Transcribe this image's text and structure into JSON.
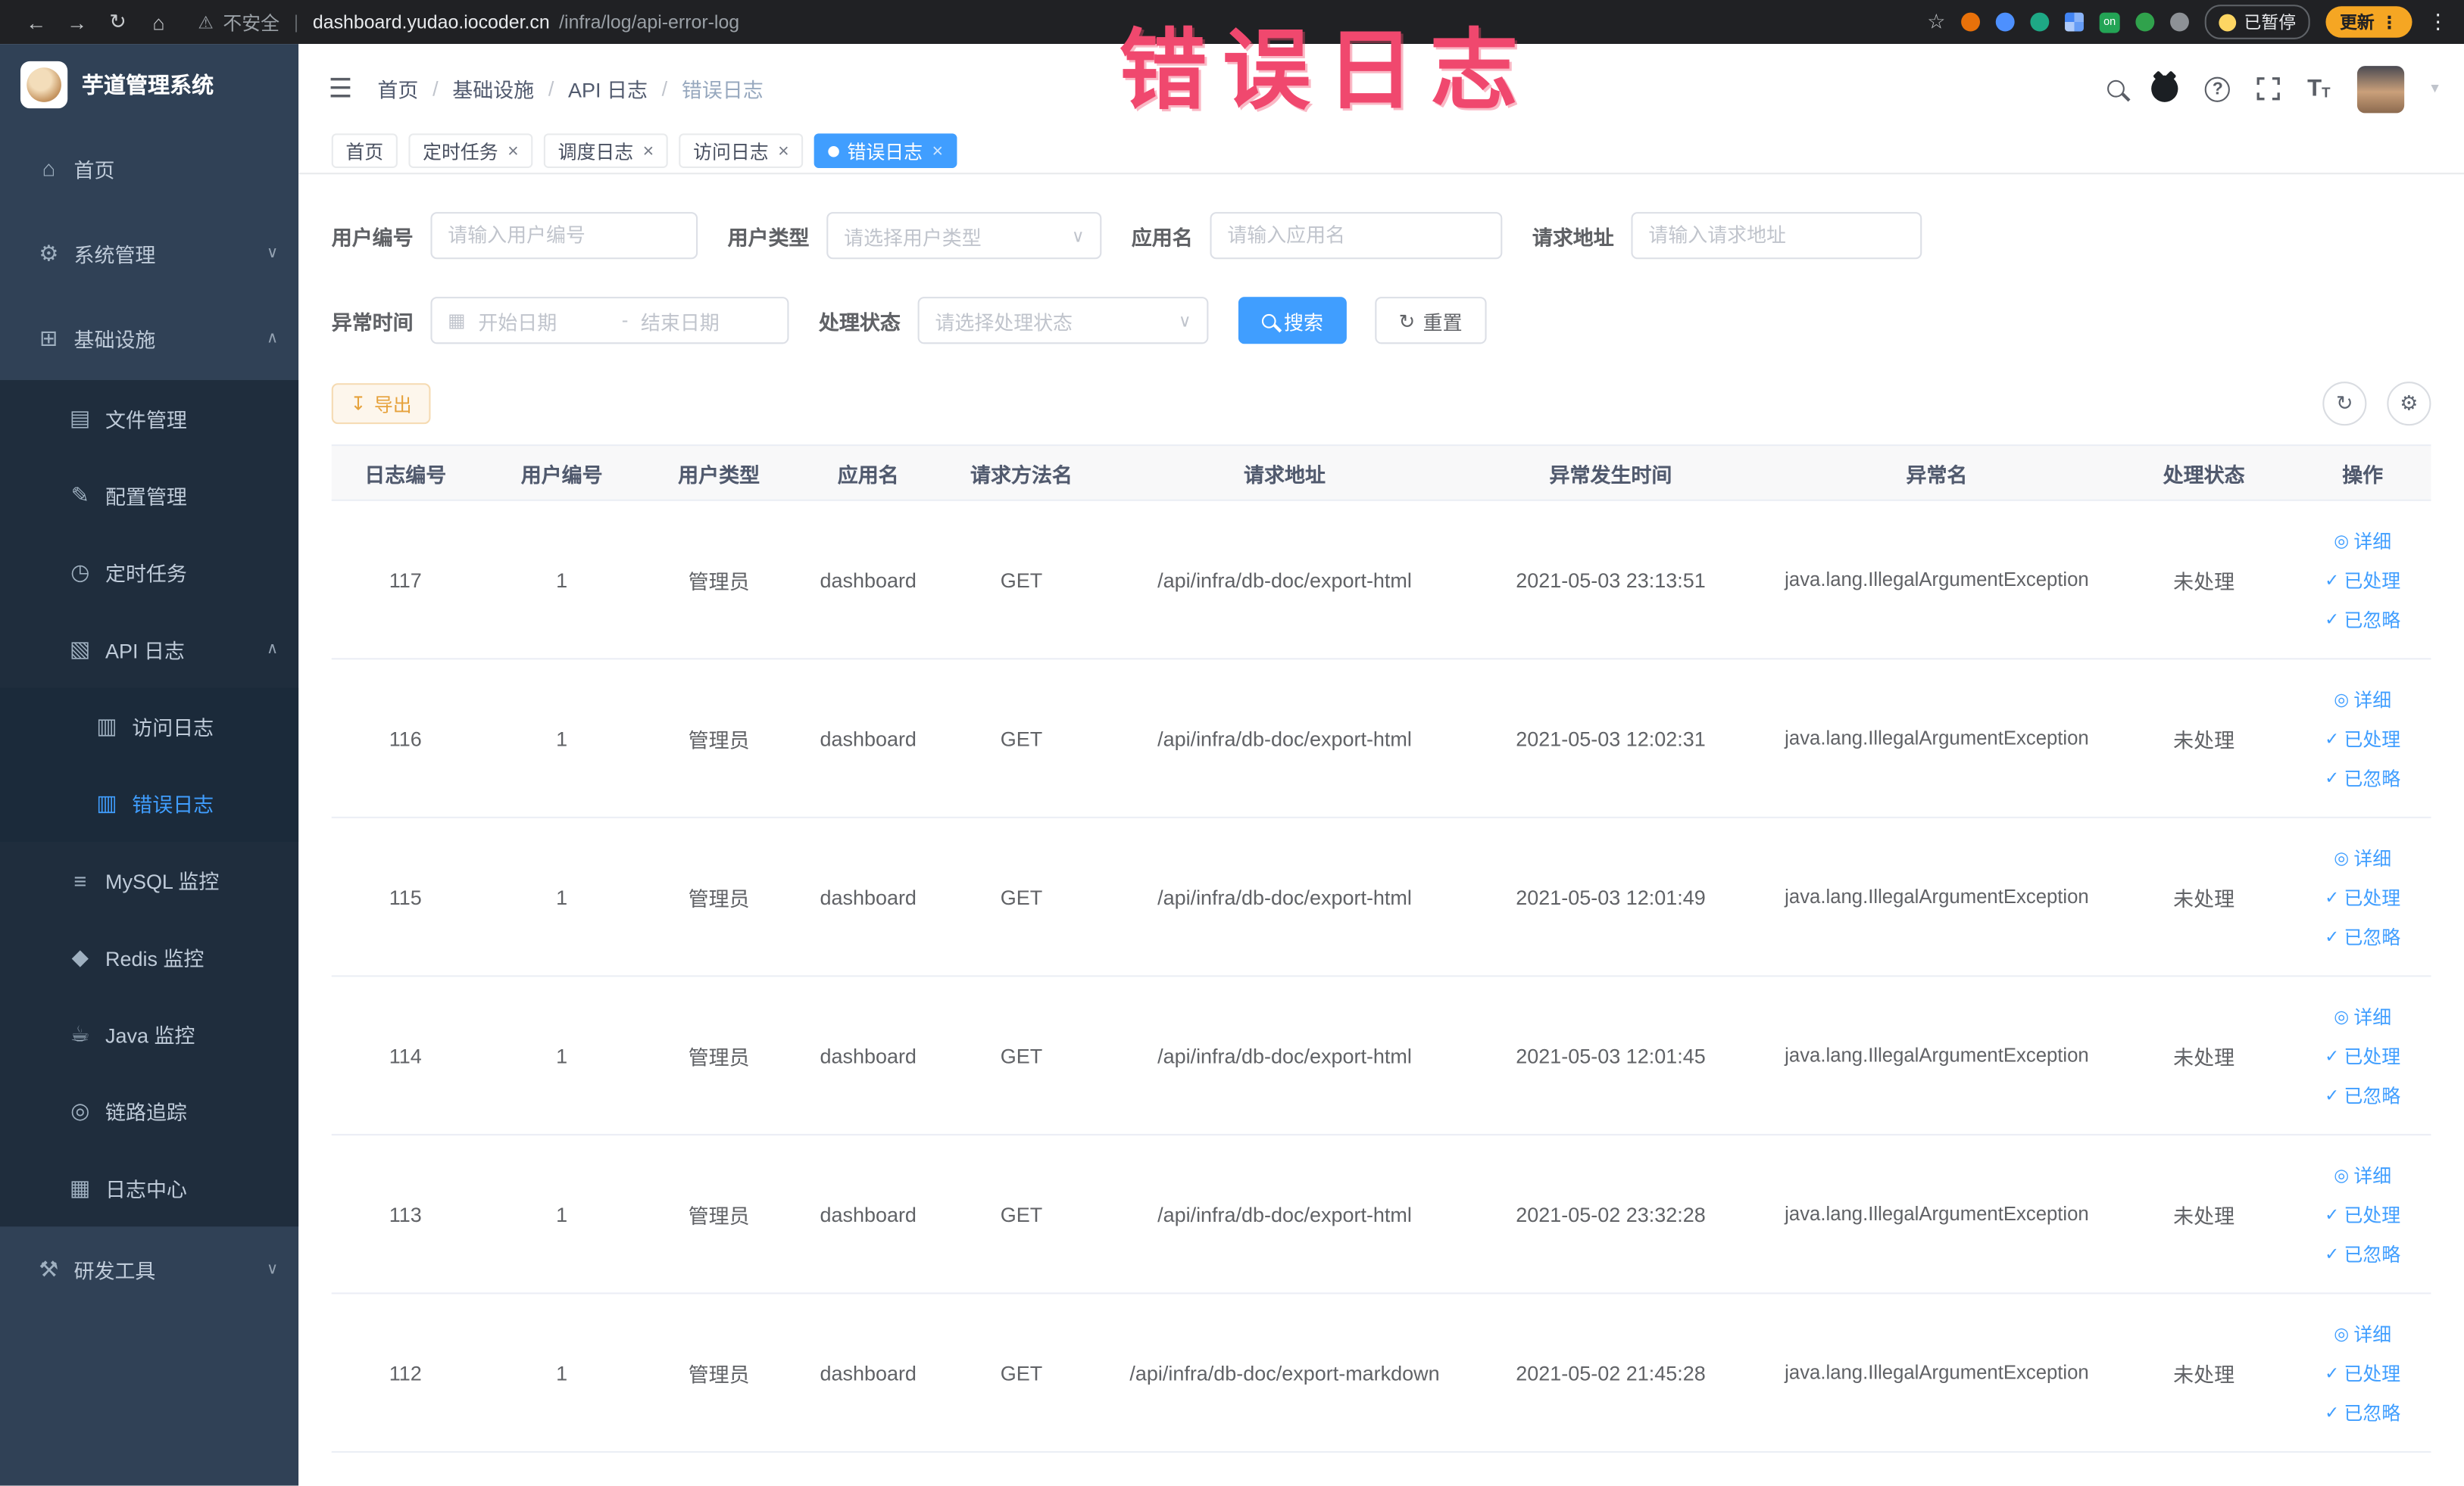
{
  "colors": {
    "accent": "#409eff",
    "chrome-bg": "#202124",
    "sidebar-bg": "#304156",
    "sidebar-sub-bg": "#1f2d3d",
    "sidebar-sub2-bg": "#1b2a3a",
    "sidebar-text": "#bfcbd9",
    "watermark": "#f0486e",
    "warning-text": "#e6a23c",
    "warning-bg": "#fdf6ec",
    "warning-border": "#f5dab1",
    "text": "#606266",
    "placeholder": "#c0c4cc",
    "border": "#dcdfe6",
    "table-border": "#ebeef5",
    "table-header-bg": "#f8f8f9",
    "update-pill": "#f5a623"
  },
  "icons": {
    "back": "←",
    "forward": "→",
    "reload": "↻",
    "home": "⌂",
    "warning": "⚠",
    "star": "☆",
    "menu_dots": "⋮",
    "hamburger": "☰",
    "caret": "▾",
    "chevron_down": "∨",
    "chevron_up": "∧",
    "close": "×",
    "sidebar_home": "⌂",
    "sidebar_system": "⚙",
    "sidebar_infra": "⊞",
    "sidebar_file": "▤",
    "sidebar_config": "✎",
    "sidebar_cron": "◷",
    "sidebar_apilog": "▧",
    "sidebar_doc": "▥",
    "sidebar_mysql": "≡",
    "sidebar_redis": "◆",
    "sidebar_java": "☕",
    "sidebar_trace": "◎",
    "sidebar_logcenter": "▦",
    "sidebar_devtools": "⚒",
    "calendar": "▦",
    "refresh": "↻",
    "gear": "⚙",
    "export": "↧",
    "eye": "◎",
    "check": "✓",
    "question": "?"
  },
  "browser": {
    "security_text": "不安全",
    "url_host": "dashboard.yudao.iocoder.cn",
    "url_path": "/infra/log/api-error-log",
    "paused_badge": "已暂停",
    "update_button": "更新"
  },
  "sidebar": {
    "app_title": "芋道管理系统",
    "items": [
      {
        "label": "首页"
      },
      {
        "label": "系统管理"
      },
      {
        "label": "基础设施"
      },
      {
        "label": "文件管理"
      },
      {
        "label": "配置管理"
      },
      {
        "label": "定时任务"
      },
      {
        "label": "API 日志"
      },
      {
        "label": "访问日志"
      },
      {
        "label": "错误日志"
      },
      {
        "label": "MySQL 监控"
      },
      {
        "label": "Redis 监控"
      },
      {
        "label": "Java 监控"
      },
      {
        "label": "链路追踪"
      },
      {
        "label": "日志中心"
      },
      {
        "label": "研发工具"
      }
    ]
  },
  "header": {
    "breadcrumb": [
      "首页",
      "基础设施",
      "API 日志",
      "错误日志"
    ]
  },
  "watermark": "错误日志",
  "tabs": [
    {
      "label": "首页",
      "closable": false,
      "active": false
    },
    {
      "label": "定时任务",
      "closable": true,
      "active": false
    },
    {
      "label": "调度日志",
      "closable": true,
      "active": false
    },
    {
      "label": "访问日志",
      "closable": true,
      "active": false
    },
    {
      "label": "错误日志",
      "closable": true,
      "active": true
    }
  ],
  "filters": {
    "user_id_label": "用户编号",
    "user_id_placeholder": "请输入用户编号",
    "user_type_label": "用户类型",
    "user_type_placeholder": "请选择用户类型",
    "app_name_label": "应用名",
    "app_name_placeholder": "请输入应用名",
    "request_url_label": "请求地址",
    "request_url_placeholder": "请输入请求地址",
    "exception_time_label": "异常时间",
    "start_date_placeholder": "开始日期",
    "range_separator": "-",
    "end_date_placeholder": "结束日期",
    "process_status_label": "处理状态",
    "process_status_placeholder": "请选择处理状态",
    "search_button": "搜索",
    "reset_button": "重置"
  },
  "toolbar": {
    "export_button": "导出"
  },
  "table": {
    "columns": [
      "日志编号",
      "用户编号",
      "用户类型",
      "应用名",
      "请求方法名",
      "请求地址",
      "异常发生时间",
      "异常名",
      "处理状态",
      "操作"
    ],
    "actions": [
      "详细",
      "已处理",
      "已忽略"
    ],
    "rows": [
      {
        "id": "117",
        "user_id": "1",
        "user_type": "管理员",
        "app": "dashboard",
        "method": "GET",
        "url": "/api/infra/db-doc/export-html",
        "time": "2021-05-03 23:13:51",
        "exception": "java.lang.IllegalArgumentException",
        "status": "未处理"
      },
      {
        "id": "116",
        "user_id": "1",
        "user_type": "管理员",
        "app": "dashboard",
        "method": "GET",
        "url": "/api/infra/db-doc/export-html",
        "time": "2021-05-03 12:02:31",
        "exception": "java.lang.IllegalArgumentException",
        "status": "未处理"
      },
      {
        "id": "115",
        "user_id": "1",
        "user_type": "管理员",
        "app": "dashboard",
        "method": "GET",
        "url": "/api/infra/db-doc/export-html",
        "time": "2021-05-03 12:01:49",
        "exception": "java.lang.IllegalArgumentException",
        "status": "未处理"
      },
      {
        "id": "114",
        "user_id": "1",
        "user_type": "管理员",
        "app": "dashboard",
        "method": "GET",
        "url": "/api/infra/db-doc/export-html",
        "time": "2021-05-03 12:01:45",
        "exception": "java.lang.IllegalArgumentException",
        "status": "未处理"
      },
      {
        "id": "113",
        "user_id": "1",
        "user_type": "管理员",
        "app": "dashboard",
        "method": "GET",
        "url": "/api/infra/db-doc/export-html",
        "time": "2021-05-02 23:32:28",
        "exception": "java.lang.IllegalArgumentException",
        "status": "未处理"
      },
      {
        "id": "112",
        "user_id": "1",
        "user_type": "管理员",
        "app": "dashboard",
        "method": "GET",
        "url": "/api/infra/db-doc/export-markdown",
        "time": "2021-05-02 21:45:28",
        "exception": "java.lang.IllegalArgumentException",
        "status": "未处理"
      }
    ]
  }
}
